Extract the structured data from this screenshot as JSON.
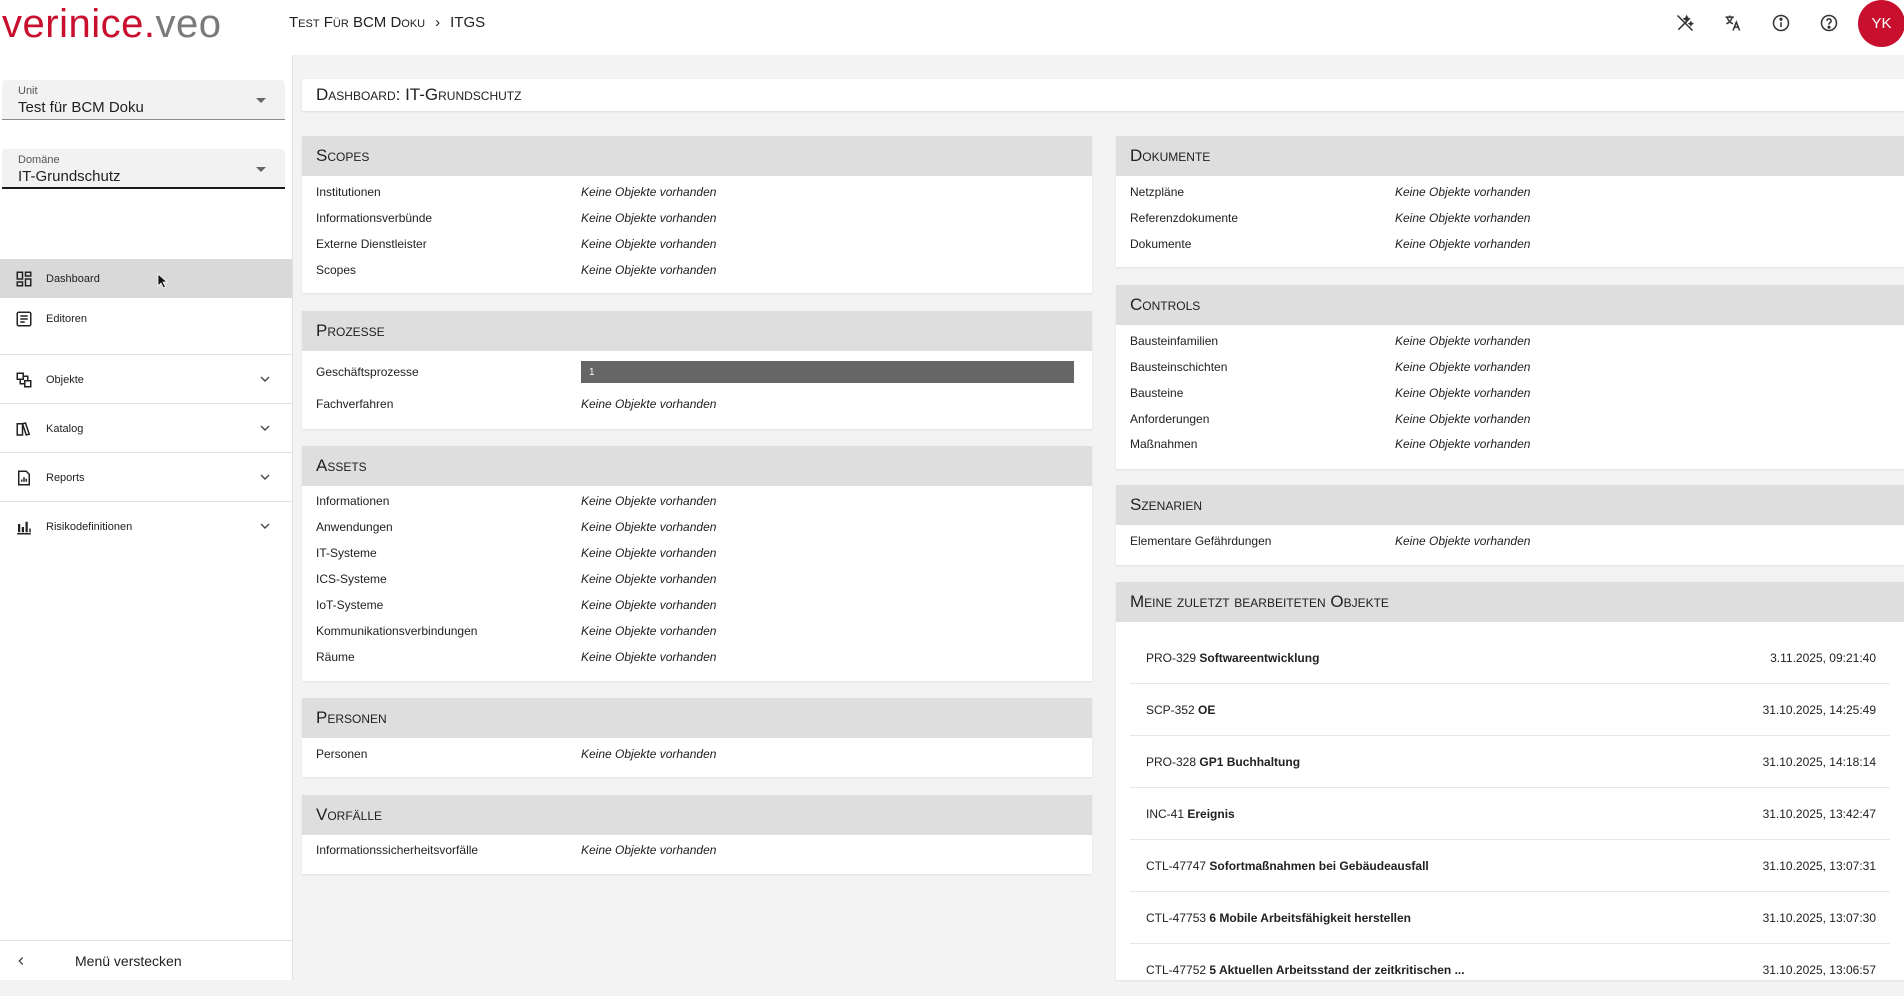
{
  "header": {
    "logo_part1": "verinice",
    "logo_part2": ".",
    "logo_part3": "veo",
    "breadcrumb": [
      "Test Für BCM Doku",
      "ITGS"
    ],
    "avatar_initials": "YK",
    "icons": [
      "magic-wand-off-icon",
      "translate-icon",
      "info-icon",
      "help-icon"
    ]
  },
  "sidebar": {
    "unit": {
      "label": "Unit",
      "value": "Test für BCM Doku"
    },
    "domain": {
      "label": "Domäne",
      "value": "IT-Grundschutz"
    },
    "items": [
      {
        "label": "Dashboard",
        "icon": "dashboard-icon"
      },
      {
        "label": "Editoren",
        "icon": "editor-icon"
      },
      {
        "label": "Objekte",
        "icon": "objects-icon"
      },
      {
        "label": "Katalog",
        "icon": "catalog-icon"
      },
      {
        "label": "Reports",
        "icon": "report-icon"
      },
      {
        "label": "Risikodefinitionen",
        "icon": "chart-icon"
      }
    ],
    "hide_menu": "Menü verstecken"
  },
  "main": {
    "title": "Dashboard: IT-Grundschutz",
    "empty": "Keine Objekte vorhanden",
    "scopes": {
      "title": "Scopes",
      "rows": [
        "Institutionen",
        "Informationsverbünde",
        "Externe Dienstleister",
        "Scopes"
      ]
    },
    "prozesse": {
      "title": "Prozesse",
      "rows": [
        "Geschäftsprozesse",
        "Fachverfahren"
      ],
      "bar_value": "1"
    },
    "assets": {
      "title": "Assets",
      "rows": [
        "Informationen",
        "Anwendungen",
        "IT-Systeme",
        "ICS-Systeme",
        "IoT-Systeme",
        "Kommunikationsverbindungen",
        "Räume"
      ]
    },
    "personen": {
      "title": "Personen",
      "rows": [
        "Personen"
      ]
    },
    "vorfaelle": {
      "title": "Vorfälle",
      "rows": [
        "Informationssicherheitsvorfälle"
      ]
    },
    "dokumente": {
      "title": "Dokumente",
      "rows": [
        "Netzpläne",
        "Referenzdokumente",
        "Dokumente"
      ]
    },
    "controls": {
      "title": "Controls",
      "rows": [
        "Bausteinfamilien",
        "Bausteinschichten",
        "Bausteine",
        "Anforderungen",
        "Maßnahmen"
      ]
    },
    "szenarien": {
      "title": "Szenarien",
      "rows": [
        "Elementare Gefährdungen"
      ]
    },
    "recent": {
      "title": "Meine zuletzt bearbeiteten Objekte",
      "items": [
        {
          "id": "PRO-329",
          "name": "Softwareentwicklung",
          "date": "3.11.2025, 09:21:40"
        },
        {
          "id": "SCP-352",
          "name": "OE",
          "date": "31.10.2025, 14:25:49"
        },
        {
          "id": "PRO-328",
          "name": "GP1 Buchhaltung",
          "date": "31.10.2025, 14:18:14"
        },
        {
          "id": "INC-41",
          "name": "Ereignis",
          "date": "31.10.2025, 13:42:47"
        },
        {
          "id": "CTL-47747",
          "name": "Sofortmaßnahmen bei Gebäudeausfall",
          "date": "31.10.2025, 13:07:31"
        },
        {
          "id": "CTL-47753",
          "name": "6 Mobile Arbeitsfähigkeit herstellen",
          "date": "31.10.2025, 13:07:30"
        },
        {
          "id": "CTL-47752",
          "name": "5 Aktuellen Arbeitsstand der zeitkritischen ...",
          "date": "31.10.2025, 13:06:57"
        }
      ]
    }
  }
}
